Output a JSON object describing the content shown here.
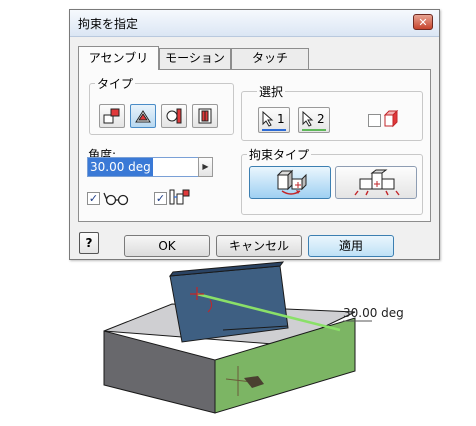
{
  "dialog": {
    "title": "拘束を指定",
    "close_icon": "close-icon"
  },
  "tabs": [
    {
      "label": "アセンブリ",
      "selected": true
    },
    {
      "label": "モーション",
      "selected": false
    },
    {
      "label": "タッチ",
      "selected": false
    }
  ],
  "type_group": {
    "label": "タイプ",
    "buttons": [
      "mate-icon",
      "angle-icon",
      "tangent-icon",
      "insert-icon"
    ],
    "selected": "angle-icon"
  },
  "selection_group": {
    "label": "選択",
    "first_label": "1",
    "second_label": "2",
    "first_color": "#2d6bd6",
    "second_color": "#5fb85a"
  },
  "angle": {
    "label": "角度:",
    "value": "30.00 deg"
  },
  "constraint_type_group": {
    "label": "拘束タイプ"
  },
  "options": {
    "show_preview_checked": true,
    "predict_offset_checked": true,
    "first_select_checked": false
  },
  "buttons": {
    "help": "?",
    "ok": "OK",
    "cancel": "キャンセル",
    "apply": "適用"
  },
  "viewport": {
    "angle_annotation": "30.00 deg",
    "top_block_color": "#3e5f82",
    "bottom_block_color": "#6b6b6f",
    "highlight_face_color": "#7cb564",
    "angle_line_color": "#8ae068"
  }
}
